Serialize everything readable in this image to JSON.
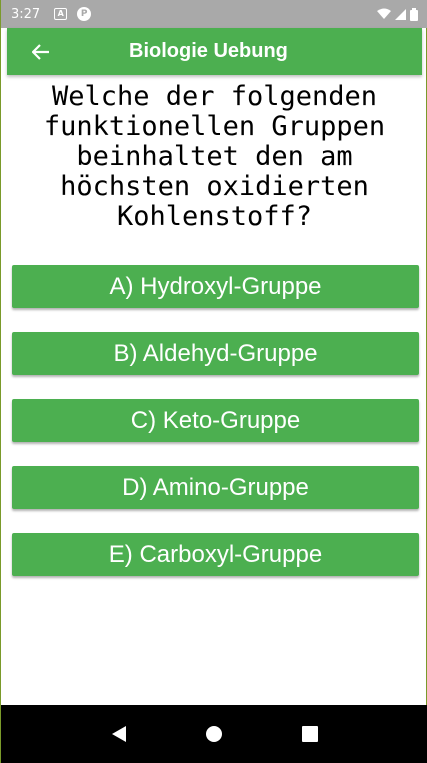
{
  "status_bar": {
    "time": "3:27",
    "icon_a": "A",
    "icon_p": "P"
  },
  "app_bar": {
    "title": "Biologie Uebung",
    "back_icon": "arrow-left"
  },
  "question": {
    "text": "Welche der folgenden\nfunktionellen Gruppen\nbeinhaltet den am\nhöchsten oxidierten\nKohlenstoff?"
  },
  "answers": [
    {
      "label": "A) Hydroxyl-Gruppe"
    },
    {
      "label": "B) Aldehyd-Gruppe"
    },
    {
      "label": "C) Keto-Gruppe"
    },
    {
      "label": "D) Amino-Gruppe"
    },
    {
      "label": "E) Carboxyl-Gruppe"
    }
  ],
  "colors": {
    "accent": "#4caf50",
    "status_bar": "#a9a9a9",
    "nav_bar": "#000000"
  }
}
